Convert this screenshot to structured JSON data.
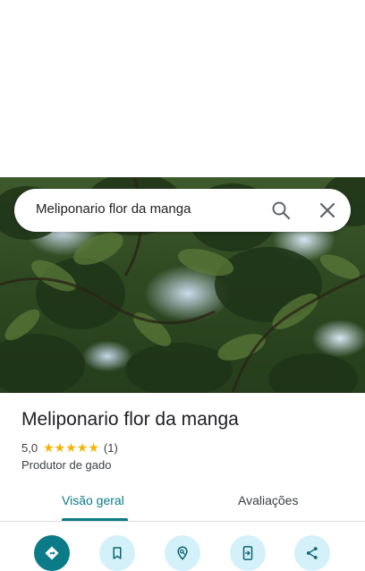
{
  "search": {
    "query": "Meliponario flor da manga",
    "icons": {
      "search": "search-icon",
      "close": "close-icon"
    }
  },
  "place": {
    "name": "Meliponario flor da manga",
    "rating": "5,0",
    "stars": 5,
    "review_count": "(1)",
    "category": "Produtor de gado"
  },
  "tabs": [
    {
      "label": "Visão geral",
      "selected": true
    },
    {
      "label": "Avaliações",
      "selected": false
    }
  ],
  "actions": [
    {
      "icon": "directions-icon"
    },
    {
      "icon": "bookmark-icon"
    },
    {
      "icon": "nearby-icon"
    },
    {
      "icon": "send-to-phone-icon"
    },
    {
      "icon": "share-icon"
    }
  ],
  "colors": {
    "accent": "#0b7b88",
    "action_bg": "#d4f1f9",
    "star": "#f4b400"
  }
}
